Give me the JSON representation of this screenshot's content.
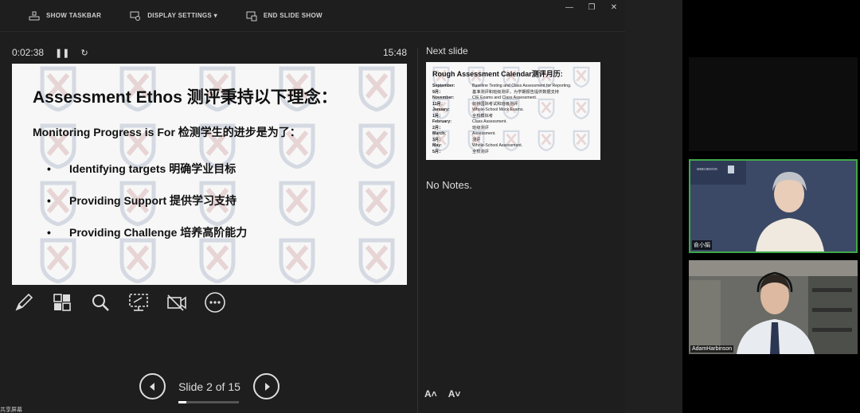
{
  "toolbar": {
    "show_taskbar": "SHOW TASKBAR",
    "display_settings": "DISPLAY SETTINGS ▾",
    "end_slide_show": "END SLIDE SHOW",
    "minimize": "—",
    "restore": "❐",
    "close": "✕"
  },
  "timer": {
    "elapsed": "0:02:38",
    "pause_icon": "pause-icon",
    "reset_icon": "reset-icon",
    "clock": "15:48"
  },
  "current_slide": {
    "title": "Assessment Ethos 测评秉持以下理念：",
    "subtitle": "Monitoring Progress is For 检测学生的进步是为了：",
    "bullets": [
      "Identifying targets 明确学业目标",
      "Providing Support 提供学习支持",
      "Providing Challenge 培养高阶能力"
    ]
  },
  "tools": [
    "pen-icon",
    "slides-grid-icon",
    "zoom-icon",
    "screen-icon",
    "camera-off-icon",
    "more-icon"
  ],
  "navigation": {
    "slide_label": "Slide 2 of 15",
    "current": 2,
    "total": 15
  },
  "next_slide": {
    "label": "Next slide",
    "title": "Rough Assessment Calendar测评月历:",
    "rows": [
      {
        "k": "September:",
        "v": "Baseline Testing and Class Assessment for Reporting."
      },
      {
        "k": "9月：",
        "v": "基准测评和班级测评，为学期报告提供数据支持"
      },
      {
        "k": "November:",
        "v": "CIE Exams and Class Assessment."
      },
      {
        "k": "11月：",
        "v": "剑桥国际考试和班级测评"
      },
      {
        "k": "January:",
        "v": "Whole-School Mock Exams."
      },
      {
        "k": "1月：",
        "v": "全校模拟考"
      },
      {
        "k": "February:",
        "v": "Class Assessment."
      },
      {
        "k": "2月：",
        "v": "班级测评"
      },
      {
        "k": "March:",
        "v": "Assessment."
      },
      {
        "k": "3月：",
        "v": "测评"
      },
      {
        "k": "May:",
        "v": "Whole-School Assessment."
      },
      {
        "k": "5月：",
        "v": "全校测评"
      }
    ]
  },
  "notes": "No Notes.",
  "font_buttons": {
    "larger": "A˄",
    "smaller": "A˅"
  },
  "participants": [
    {
      "name": "俞小娟",
      "logo": "MERCHISTON"
    },
    {
      "name": "AdamHarbinson"
    }
  ],
  "shared_label": "共享屏幕"
}
